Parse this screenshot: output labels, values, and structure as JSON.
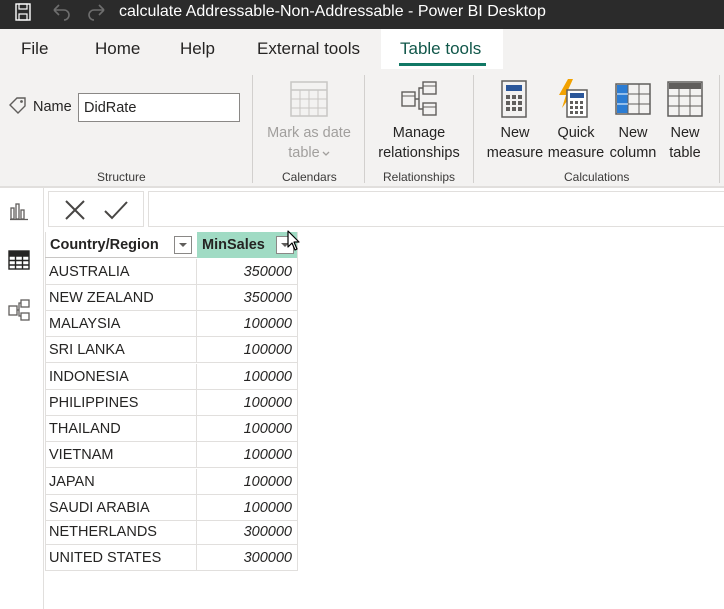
{
  "window": {
    "title": "calculate Addressable-Non-Addressable - Power BI Desktop"
  },
  "menu": {
    "items": [
      {
        "label": "File"
      },
      {
        "label": "Home"
      },
      {
        "label": "Help"
      },
      {
        "label": "External tools"
      },
      {
        "label": "Table tools"
      }
    ]
  },
  "ribbon": {
    "structure": {
      "name_label": "Name",
      "name_value": "DidRate",
      "group_label": "Structure"
    },
    "calendars": {
      "mark_as_date_line1": "Mark as date",
      "mark_as_date_line2": "table",
      "group_label": "Calendars"
    },
    "relationships": {
      "manage_line1": "Manage",
      "manage_line2": "relationships",
      "group_label": "Relationships"
    },
    "calculations": {
      "new_measure_line1": "New",
      "new_measure_line2": "measure",
      "quick_measure_line1": "Quick",
      "quick_measure_line2": "measure",
      "new_column_line1": "New",
      "new_column_line2": "column",
      "new_table_line1": "New",
      "new_table_line2": "table",
      "group_label": "Calculations"
    }
  },
  "colors": {
    "accent": "#117865",
    "selected_column": "#a0dbc4",
    "titlebar": "#2b2b2b"
  },
  "grid": {
    "columns": [
      "Country/Region",
      "MinSales"
    ],
    "rows": [
      {
        "country": "AUSTRALIA",
        "min_sales": "350000"
      },
      {
        "country": "NEW ZEALAND",
        "min_sales": "350000"
      },
      {
        "country": "MALAYSIA",
        "min_sales": "100000"
      },
      {
        "country": "SRI LANKA",
        "min_sales": "100000"
      },
      {
        "country": "INDONESIA",
        "min_sales": "100000"
      },
      {
        "country": "PHILIPPINES",
        "min_sales": "100000"
      },
      {
        "country": "THAILAND",
        "min_sales": "100000"
      },
      {
        "country": "VIETNAM",
        "min_sales": "100000"
      },
      {
        "country": "JAPAN",
        "min_sales": "100000"
      },
      {
        "country": "SAUDI ARABIA",
        "min_sales": "100000"
      },
      {
        "country": "NETHERLANDS",
        "min_sales": "300000"
      },
      {
        "country": "UNITED STATES",
        "min_sales": "300000"
      }
    ]
  }
}
